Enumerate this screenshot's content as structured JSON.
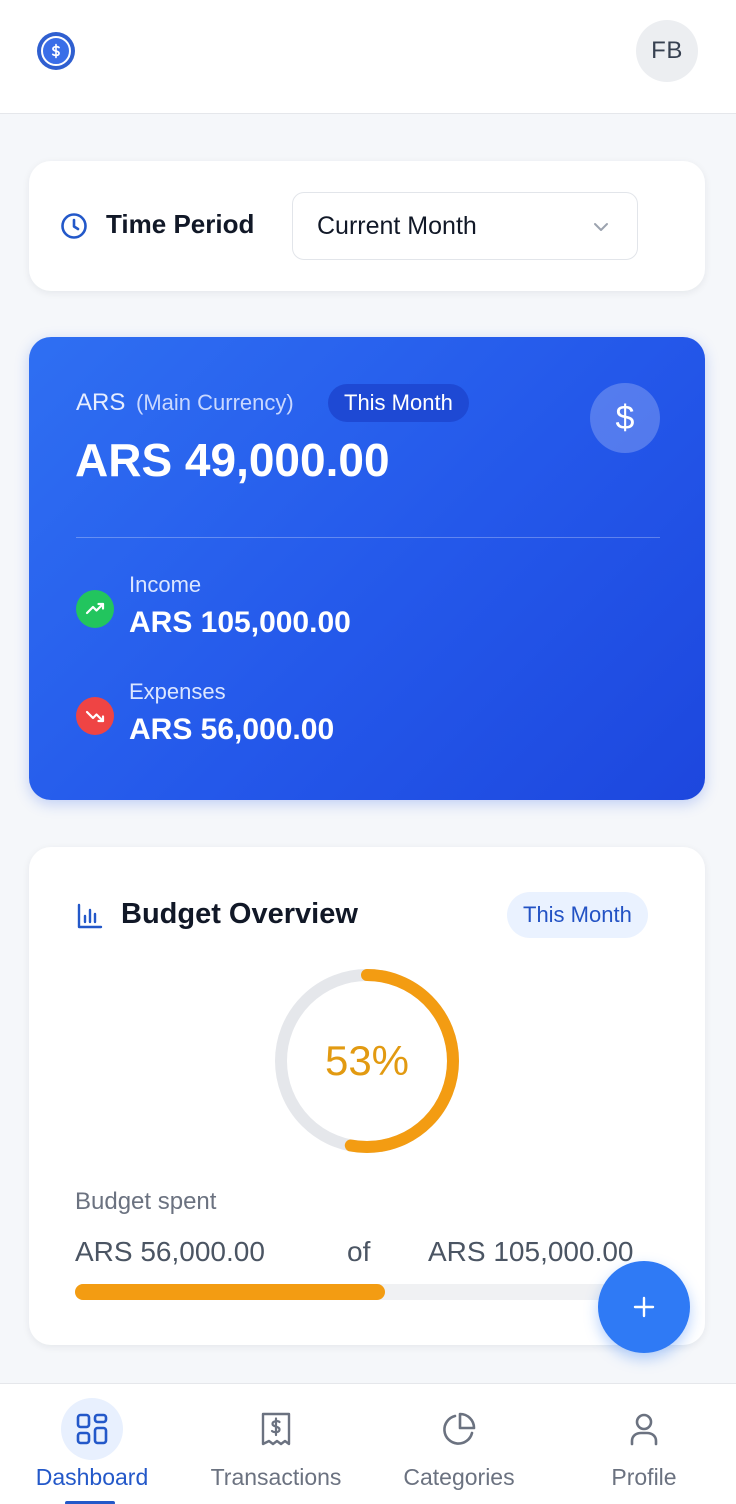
{
  "header": {
    "logo_icon": "dollar-coin-icon",
    "avatar_initials": "FB"
  },
  "period": {
    "label": "Time Period",
    "icon": "clock-icon",
    "selected": "Current Month"
  },
  "balance": {
    "currency": "ARS",
    "currency_note": "(Main Currency)",
    "period_badge": "This Month",
    "amount": "ARS 49,000.00",
    "icon": "dollar-icon",
    "income_label": "Income",
    "income_value": "ARS 105,000.00",
    "expenses_label": "Expenses",
    "expenses_value": "ARS 56,000.00"
  },
  "budget": {
    "title": "Budget Overview",
    "period_badge": "This Month",
    "percent_text": "53%",
    "percent": 0.53,
    "spent_label": "Budget spent",
    "spent_value": "ARS 56,000.00",
    "of_text": "of",
    "total_value": "ARS 105,000.00"
  },
  "nav": {
    "items": [
      {
        "label": "Dashboard",
        "icon": "grid-icon",
        "active": true
      },
      {
        "label": "Transactions",
        "icon": "receipt-icon",
        "active": false
      },
      {
        "label": "Categories",
        "icon": "pie-chart-icon",
        "active": false
      },
      {
        "label": "Profile",
        "icon": "user-icon",
        "active": false
      }
    ]
  },
  "colors": {
    "primary": "#2458ea",
    "income": "#22c55e",
    "expense": "#ef4444",
    "budget": "#f39c12"
  }
}
